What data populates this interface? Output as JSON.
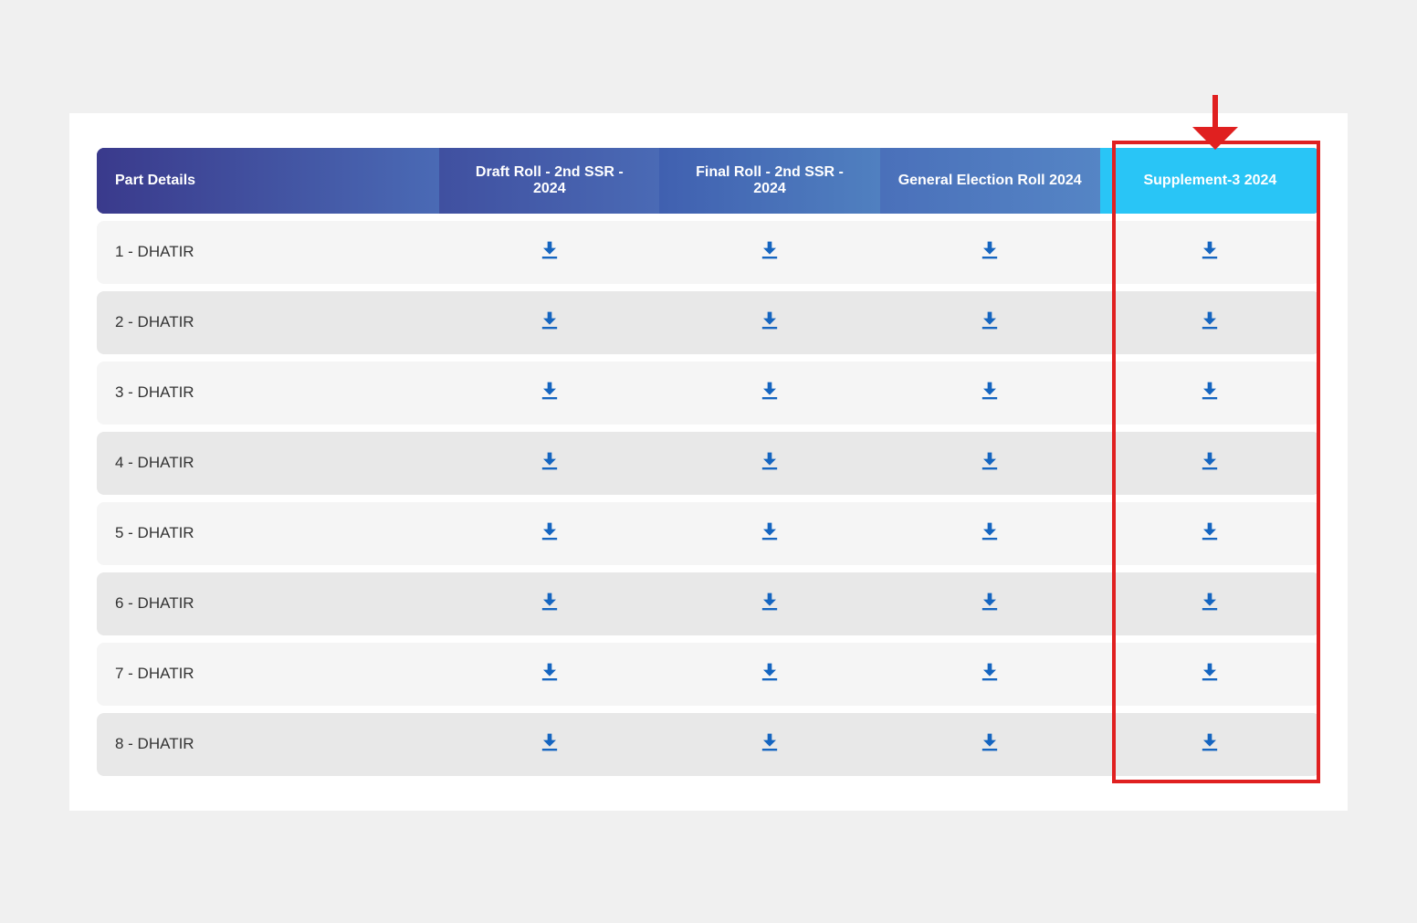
{
  "header": {
    "col1": "Part Details",
    "col2": "Draft Roll - 2nd SSR - 2024",
    "col3": "Final Roll - 2nd SSR - 2024",
    "col4": "General Election Roll 2024",
    "col5": "Supplement-3 2024"
  },
  "rows": [
    {
      "part": "1 - DHATIR"
    },
    {
      "part": "2 - DHATIR"
    },
    {
      "part": "3 - DHATIR"
    },
    {
      "part": "4 - DHATIR"
    },
    {
      "part": "5 - DHATIR"
    },
    {
      "part": "6 - DHATIR"
    },
    {
      "part": "7 - DHATIR"
    },
    {
      "part": "8 - DHATIR"
    }
  ],
  "colors": {
    "header_bg_start": "#3a3a8c",
    "header_bg_end": "#4a6ab5",
    "header_highlight": "#29c5f6",
    "download_blue": "#1565c0",
    "highlight_border": "#e02020"
  }
}
